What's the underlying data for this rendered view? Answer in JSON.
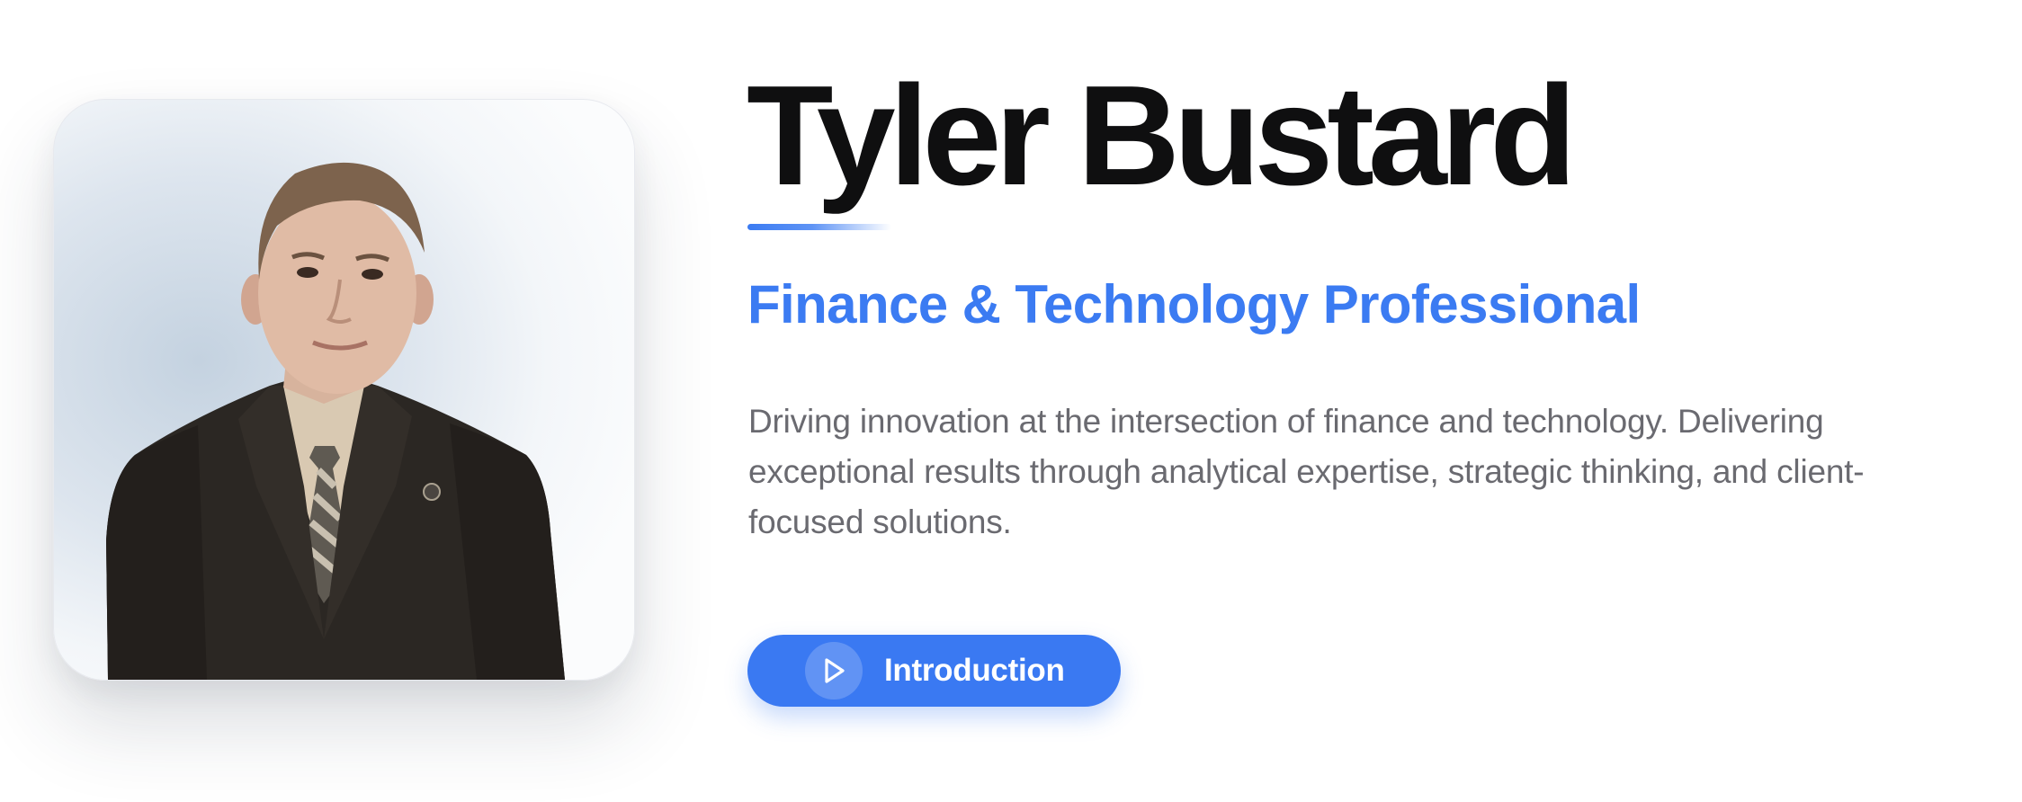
{
  "profile": {
    "name": "Tyler Bustard",
    "title": "Finance & Technology Professional",
    "description": "Driving innovation at the intersection of finance and technology. Delivering exceptional results through analytical expertise, strategic thinking, and client-focused solutions.",
    "portrait_icon": "person-portrait"
  },
  "cta": {
    "label": "Introduction",
    "icon": "play-icon"
  },
  "colors": {
    "accent": "#3b7bf2",
    "heading": "#0f0f10",
    "body_text": "#6a6a70",
    "background": "#ffffff"
  }
}
